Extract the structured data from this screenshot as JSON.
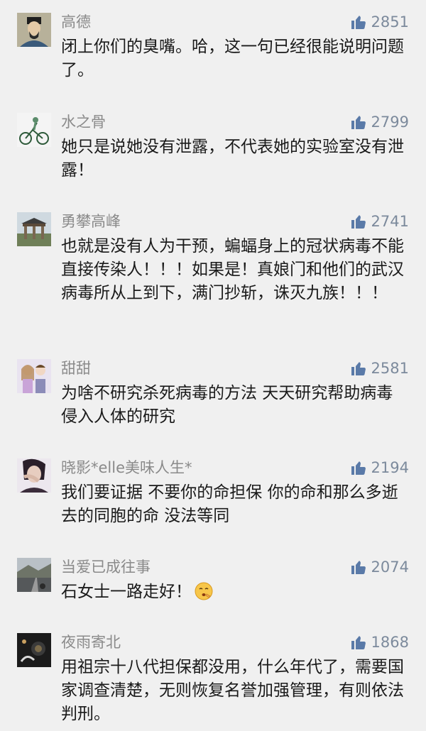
{
  "comments": [
    {
      "username": "高德",
      "likes": "2851",
      "text": "闭上你们的臭嘴。哈，这一句已经很能说明问题了。",
      "avatar_icon": "portrait-avatar-icon"
    },
    {
      "username": "水之骨",
      "likes": "2799",
      "text": "她只是说她没有泄露，不代表她的实验室没有泄露！",
      "avatar_icon": "cyclist-avatar-icon"
    },
    {
      "username": "勇攀高峰",
      "likes": "2741",
      "text": "也就是没有人为干预，蝙蝠身上的冠状病毒不能直接传染人！！！如果是！真娘门和他们的武汉病毒所从上到下，满门抄斩，诛灭九族！！！",
      "avatar_icon": "gate-avatar-icon"
    },
    {
      "username": "甜甜",
      "likes": "2581",
      "text": "为啥不研究杀死病毒的方法 天天研究帮助病毒侵入人体的研究",
      "avatar_icon": "anime-couple-avatar-icon"
    },
    {
      "username": "晓影*elle美味人生*",
      "likes": "2194",
      "text": "我们要证据 不要你的命担保 你的命和那么多逝去的同胞的命 没法等同",
      "avatar_icon": "woman-avatar-icon"
    },
    {
      "username": "当爱已成往事",
      "likes": "2074",
      "text": "石女士一路走好！",
      "emoji": "hushed-face-emoji",
      "avatar_icon": "road-avatar-icon"
    },
    {
      "username": "夜雨寄北",
      "likes": "1868",
      "text": "用祖宗十八代担保都没用，什么年代了，需要国家调查清楚，无则恢复名誉加强管理，有则依法判刑。",
      "avatar_icon": "dark-photo-avatar-icon"
    }
  ],
  "colors": {
    "background": "#f0f0f0",
    "like_icon": "#5a7aa8",
    "like_count": "#7c8a9c",
    "username": "#8a8a8a",
    "text": "#1a1a1a"
  }
}
